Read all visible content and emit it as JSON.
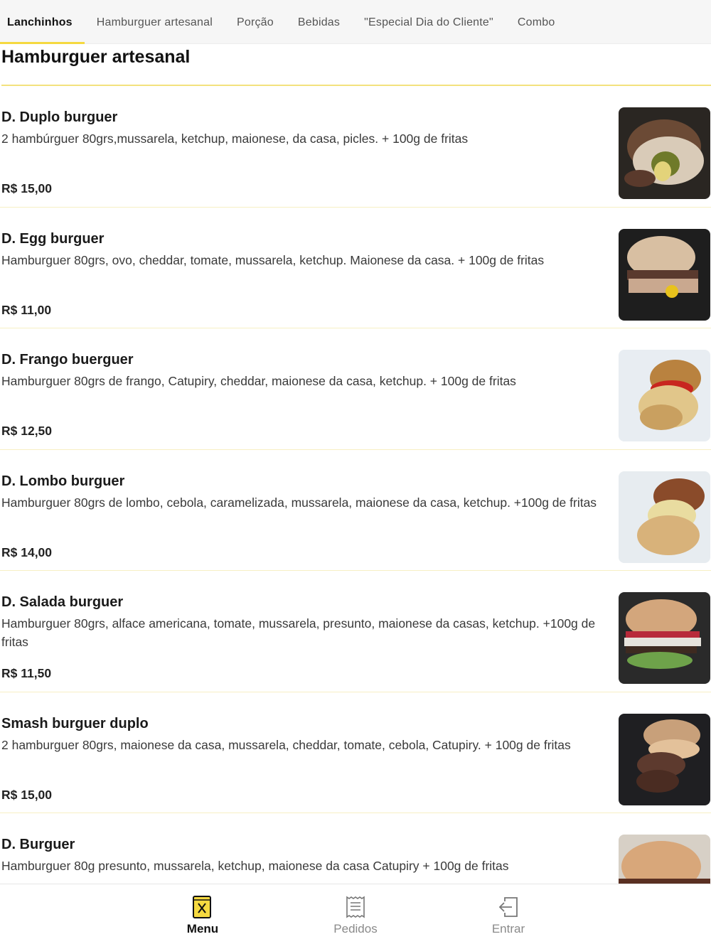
{
  "tabs": [
    {
      "label": "Lanchinhos",
      "active": true
    },
    {
      "label": "Hamburguer artesanal",
      "active": false
    },
    {
      "label": "Porção",
      "active": false
    },
    {
      "label": "Bebidas",
      "active": false
    },
    {
      "label": "\"Especial Dia do Cliente\"",
      "active": false
    },
    {
      "label": "Combo",
      "active": false
    }
  ],
  "section": {
    "title": "Hamburguer artesanal"
  },
  "items": [
    {
      "name": "D. Duplo burguer",
      "description": "2 hambúrguer 80grs,mussarela, ketchup, maionese, da casa, picles. + 100g de fritas",
      "price": "R$ 15,00"
    },
    {
      "name": "D. Egg burguer",
      "description": "Hamburguer 80grs, ovo, cheddar, tomate, mussarela, ketchup. Maionese da casa. + 100g de fritas",
      "price": "R$ 11,00"
    },
    {
      "name": "D. Frango buerguer",
      "description": "Hamburguer 80grs de frango, Catupiry, cheddar, maionese da casa, ketchup. + 100g de fritas",
      "price": "R$ 12,50"
    },
    {
      "name": "D. Lombo burguer",
      "description": "Hamburguer 80grs de lombo, cebola, caramelizada, mussarela, maionese da casa, ketchup. +100g de fritas",
      "price": "R$ 14,00"
    },
    {
      "name": "D. Salada burguer",
      "description": "Hamburguer 80grs, alface americana, tomate, mussarela, presunto, maionese da casas, ketchup. +100g de fritas",
      "price": "R$ 11,50"
    },
    {
      "name": "Smash burguer duplo",
      "description": "2 hamburguer 80grs, maionese da casa, mussarela, cheddar, tomate, cebola, Catupiry. + 100g de fritas",
      "price": "R$ 15,00"
    },
    {
      "name": "D. Burguer",
      "description": "Hamburguer 80g presunto, mussarela, ketchup, maionese da casa Catupiry + 100g de fritas",
      "price": ""
    }
  ],
  "bottom_nav": [
    {
      "label": "Menu",
      "icon": "menu-book-icon",
      "active": true
    },
    {
      "label": "Pedidos",
      "icon": "receipt-icon",
      "active": false
    },
    {
      "label": "Entrar",
      "icon": "login-icon",
      "active": false
    }
  ],
  "colors": {
    "accent": "#f5d940",
    "divider": "#f3e27d"
  }
}
